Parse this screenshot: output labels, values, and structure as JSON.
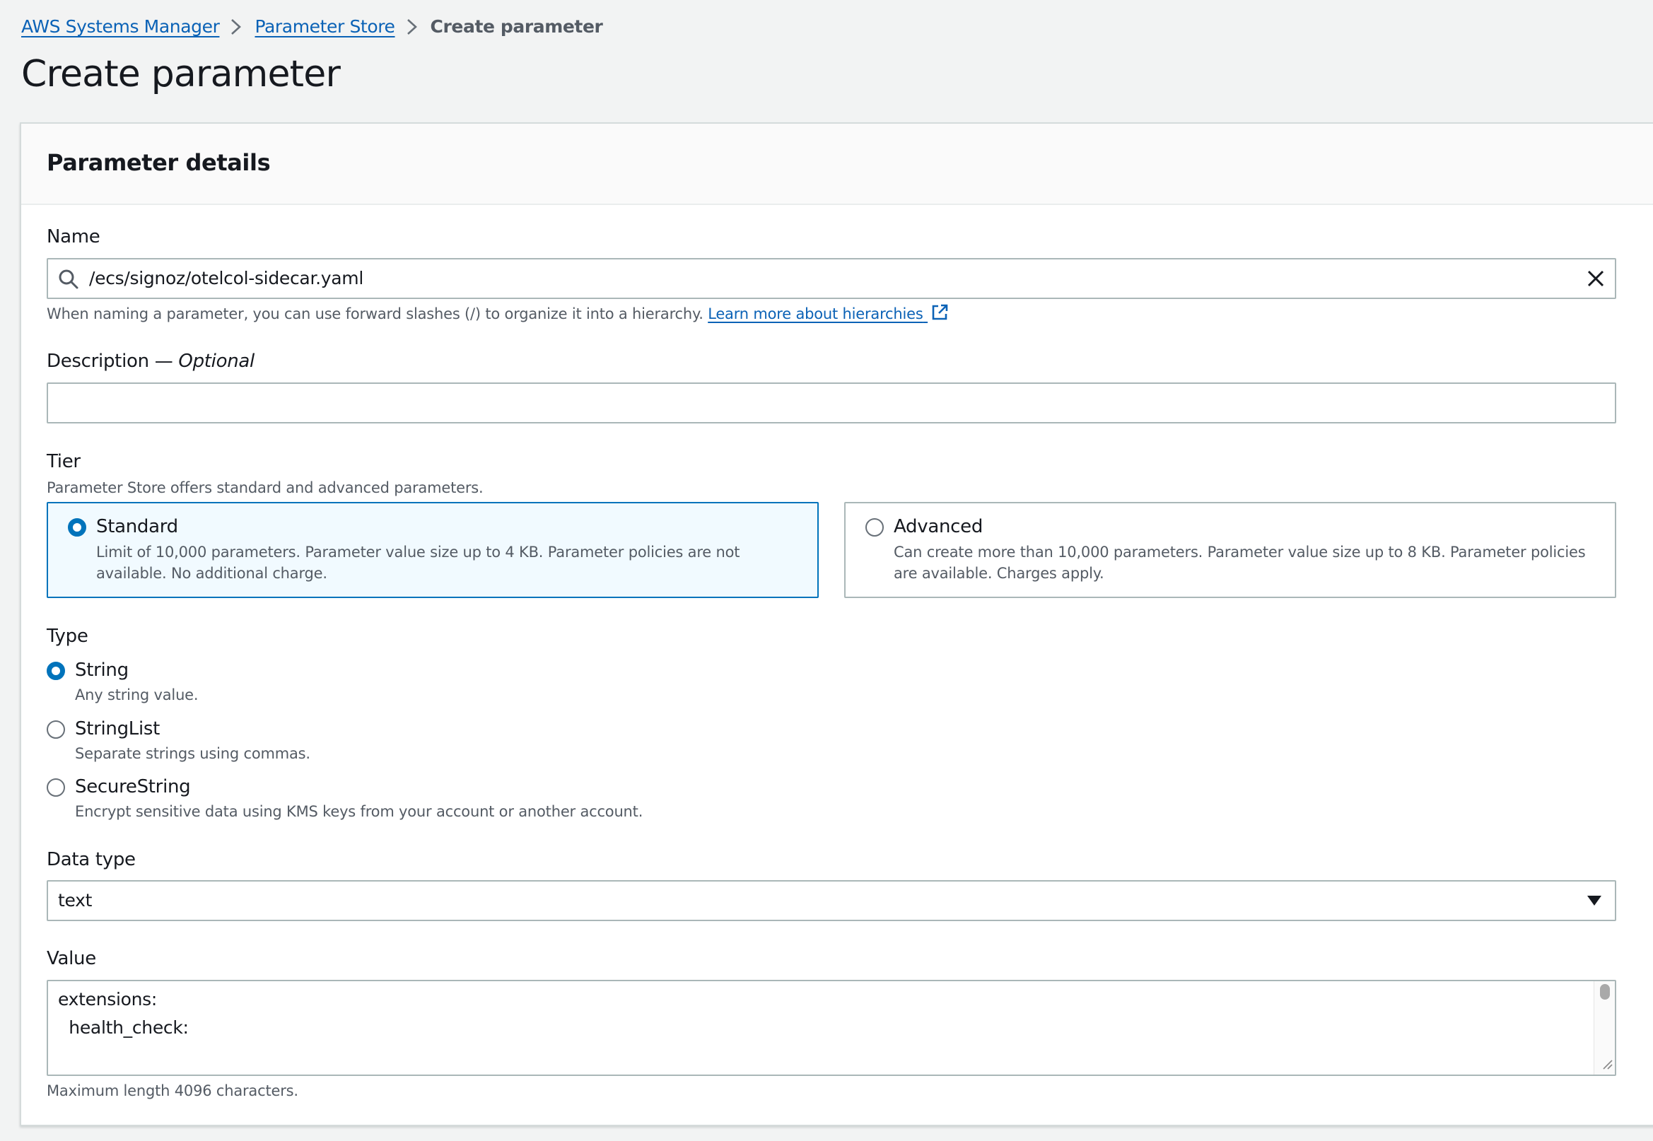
{
  "breadcrumb": {
    "items": [
      "AWS Systems Manager",
      "Parameter Store"
    ],
    "current": "Create parameter"
  },
  "page_title": "Create parameter",
  "panel": {
    "title": "Parameter details",
    "name": {
      "label": "Name",
      "value": "/ecs/signoz/otelcol-sidecar.yaml",
      "hint": "When naming a parameter, you can use forward slashes (/) to organize it into a hierarchy.",
      "hint_link": "Learn more about hierarchies",
      "icons": [
        "search-icon",
        "clear-icon",
        "external-link-icon"
      ]
    },
    "description": {
      "label": "Description —",
      "label_optional": "Optional",
      "value": ""
    },
    "tier": {
      "label": "Tier",
      "hint": "Parameter Store offers standard and advanced parameters.",
      "options": [
        {
          "title": "Standard",
          "desc": "Limit of 10,000 parameters. Parameter value size up to 4 KB. Parameter policies are not available. No additional charge.",
          "selected": true
        },
        {
          "title": "Advanced",
          "desc": "Can create more than 10,000 parameters. Parameter value size up to 8 KB. Parameter policies are available. Charges apply.",
          "selected": false
        }
      ]
    },
    "type": {
      "label": "Type",
      "options": [
        {
          "title": "String",
          "desc": "Any string value.",
          "selected": true
        },
        {
          "title": "StringList",
          "desc": "Separate strings using commas.",
          "selected": false
        },
        {
          "title": "SecureString",
          "desc": "Encrypt sensitive data using KMS keys from your account or another account.",
          "selected": false
        }
      ]
    },
    "data_type": {
      "label": "Data type",
      "value": "text",
      "icon": "caret-down-icon"
    },
    "value": {
      "label": "Value",
      "lines": [
        "extensions:",
        "  health_check:"
      ],
      "hint": "Maximum length 4096 characters."
    }
  },
  "colors": {
    "link": "#0b62b6",
    "accent": "#0073bb",
    "selected_tile_bg": "#f1faff",
    "page_bg": "#f2f3f3",
    "border": "#aab7b8"
  }
}
